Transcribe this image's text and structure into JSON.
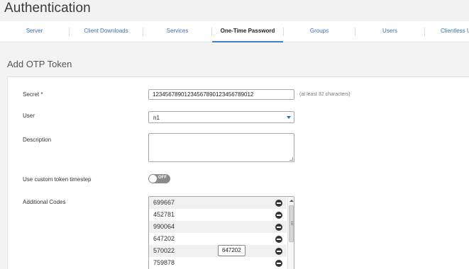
{
  "header": {
    "title": "Authentication"
  },
  "tabs": [
    {
      "label": "Server"
    },
    {
      "label": "Client Downloads"
    },
    {
      "label": "Services"
    },
    {
      "label": "One-Time Password",
      "active": true
    },
    {
      "label": "Groups"
    },
    {
      "label": "Users"
    },
    {
      "label": "Clientless U"
    }
  ],
  "section": {
    "title": "Add OTP Token"
  },
  "form": {
    "secret": {
      "label": "Secret *",
      "value": "12345678901234567890123456789012",
      "hint": "(at least 32 characters)"
    },
    "user": {
      "label": "User",
      "value": "n1"
    },
    "description": {
      "label": "Description",
      "value": ""
    },
    "timestep": {
      "label": "Use custom token timestep",
      "state": "OFF"
    },
    "codes": {
      "label": "Additional Codes",
      "items": [
        "699667",
        "452781",
        "990064",
        "647202",
        "570022",
        "759878"
      ],
      "tooltip": "647202"
    }
  },
  "colors": {
    "accent": "#3d7fc1",
    "link": "#3b6fb0",
    "toggle_off": "#8a8a8a"
  }
}
